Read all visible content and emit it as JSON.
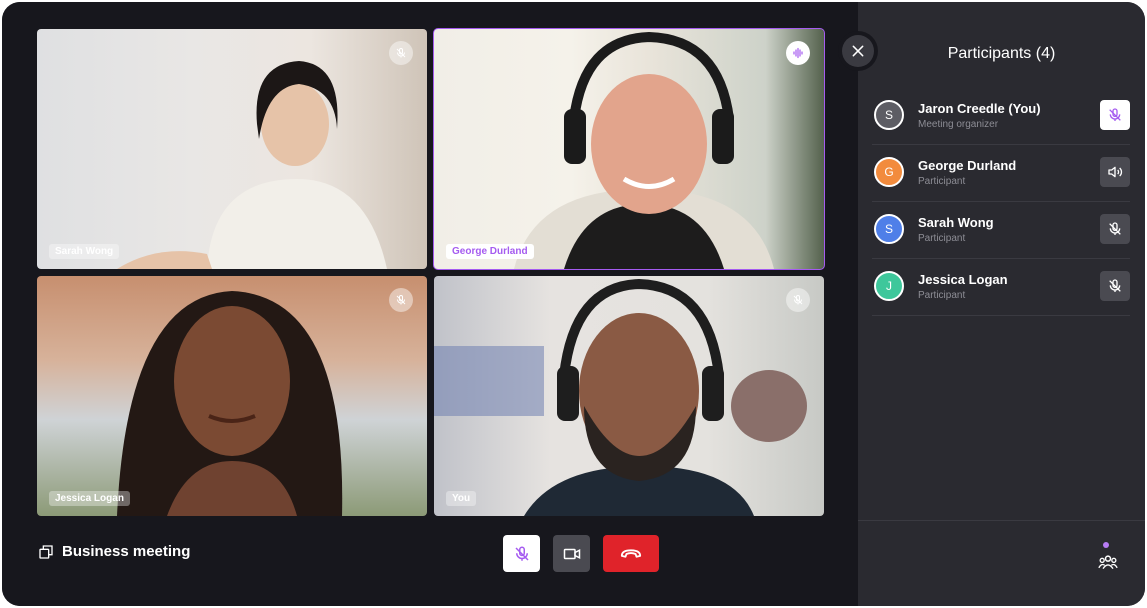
{
  "tiles": [
    {
      "name": "Sarah Wong",
      "mic": "muted",
      "active": false
    },
    {
      "name": "George Durland",
      "mic": "speaking",
      "active": true
    },
    {
      "name": "Jessica Logan",
      "mic": "muted",
      "active": false
    },
    {
      "name": "You",
      "mic": "muted",
      "active": false
    }
  ],
  "meeting": {
    "title": "Business meeting",
    "icon": "copy-icon"
  },
  "controls": {
    "mic": "mic-off-icon",
    "camera": "video-camera-icon",
    "end": "hang-up-icon"
  },
  "panel": {
    "title": "Participants (4)",
    "participants": [
      {
        "initial": "S",
        "name": "Jaron Creedle (You)",
        "role": "Meeting organizer",
        "avatar_color": "#5d5d64",
        "audio": "mic-off",
        "audio_active": true
      },
      {
        "initial": "G",
        "name": "George Durland",
        "role": "Participant",
        "avatar_color": "#f28b3d",
        "audio": "speaker",
        "audio_active": false
      },
      {
        "initial": "S",
        "name": "Sarah Wong",
        "role": "Participant",
        "avatar_color": "#4f7fe8",
        "audio": "mic-off",
        "audio_active": false
      },
      {
        "initial": "J",
        "name": "Jessica Logan",
        "role": "Participant",
        "avatar_color": "#3ec79b",
        "audio": "mic-off",
        "audio_active": false
      }
    ]
  },
  "colors": {
    "accent": "#a55bf0",
    "end_call": "#e0232a",
    "background": "#17171d",
    "panel": "#2a2a30"
  }
}
